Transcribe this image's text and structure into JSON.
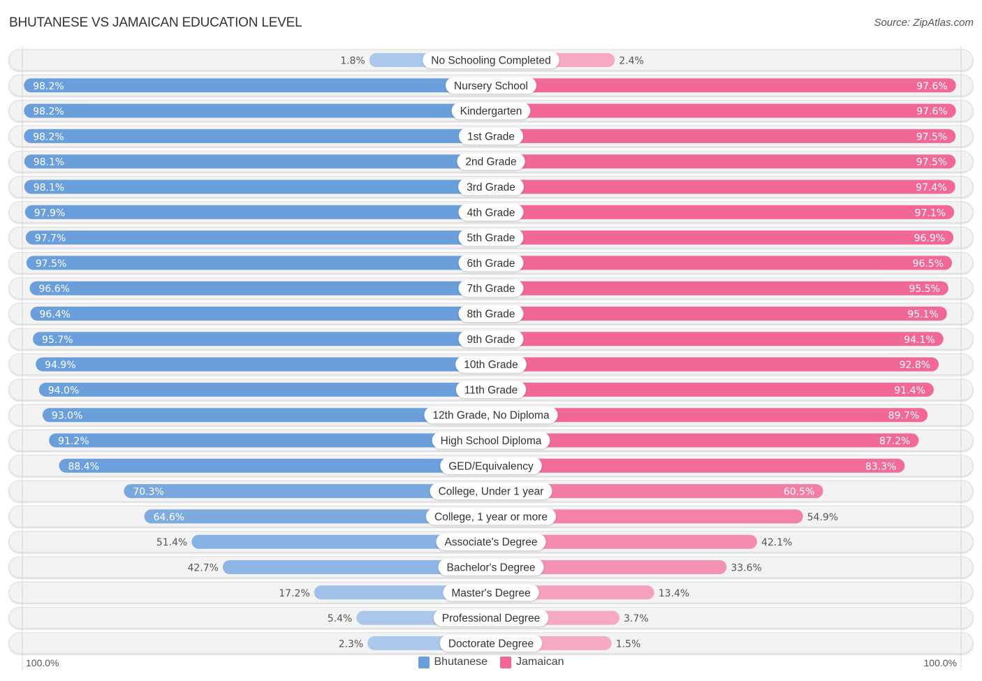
{
  "header": {
    "title": "BHUTANESE VS JAMAICAN EDUCATION LEVEL",
    "source": "Source: ZipAtlas.com"
  },
  "colors": {
    "bhutanese": "#6a9fdc",
    "jamaican": "#f06893"
  },
  "axis": {
    "left_label": "100.0%",
    "right_label": "100.0%"
  },
  "legend": {
    "items": [
      {
        "label": "Bhutanese",
        "color": "#6a9fdc"
      },
      {
        "label": "Jamaican",
        "color": "#f06893"
      }
    ]
  },
  "chart_data": {
    "type": "bar",
    "orientation": "horizontal-diverging",
    "title": "BHUTANESE VS JAMAICAN EDUCATION LEVEL",
    "xlabel": "",
    "ylabel": "",
    "xlim": [
      0,
      100
    ],
    "unit": "%",
    "legend_position": "bottom-center",
    "categories": [
      "No Schooling Completed",
      "Nursery School",
      "Kindergarten",
      "1st Grade",
      "2nd Grade",
      "3rd Grade",
      "4th Grade",
      "5th Grade",
      "6th Grade",
      "7th Grade",
      "8th Grade",
      "9th Grade",
      "10th Grade",
      "11th Grade",
      "12th Grade, No Diploma",
      "High School Diploma",
      "GED/Equivalency",
      "College, Under 1 year",
      "College, 1 year or more",
      "Associate's Degree",
      "Bachelor's Degree",
      "Master's Degree",
      "Professional Degree",
      "Doctorate Degree"
    ],
    "series": [
      {
        "name": "Bhutanese",
        "side": "left",
        "values": [
          1.8,
          98.2,
          98.2,
          98.2,
          98.1,
          98.1,
          97.9,
          97.7,
          97.5,
          96.6,
          96.4,
          95.7,
          94.9,
          94.0,
          93.0,
          91.2,
          88.4,
          70.3,
          64.6,
          51.4,
          42.7,
          17.2,
          5.4,
          2.3
        ],
        "labels": [
          "1.8%",
          "98.2%",
          "98.2%",
          "98.2%",
          "98.1%",
          "98.1%",
          "97.9%",
          "97.7%",
          "97.5%",
          "96.6%",
          "96.4%",
          "95.7%",
          "94.9%",
          "94.0%",
          "93.0%",
          "91.2%",
          "88.4%",
          "70.3%",
          "64.6%",
          "51.4%",
          "42.7%",
          "17.2%",
          "5.4%",
          "2.3%"
        ]
      },
      {
        "name": "Jamaican",
        "side": "right",
        "values": [
          2.4,
          97.6,
          97.6,
          97.5,
          97.5,
          97.4,
          97.1,
          96.9,
          96.5,
          95.5,
          95.1,
          94.1,
          92.8,
          91.4,
          89.7,
          87.2,
          83.3,
          60.5,
          54.9,
          42.1,
          33.6,
          13.4,
          3.7,
          1.5
        ],
        "labels": [
          "2.4%",
          "97.6%",
          "97.6%",
          "97.5%",
          "97.5%",
          "97.4%",
          "97.1%",
          "96.9%",
          "96.5%",
          "95.5%",
          "95.1%",
          "94.1%",
          "92.8%",
          "91.4%",
          "89.7%",
          "87.2%",
          "83.3%",
          "60.5%",
          "54.9%",
          "42.1%",
          "33.6%",
          "13.4%",
          "3.7%",
          "1.5%"
        ]
      }
    ]
  }
}
